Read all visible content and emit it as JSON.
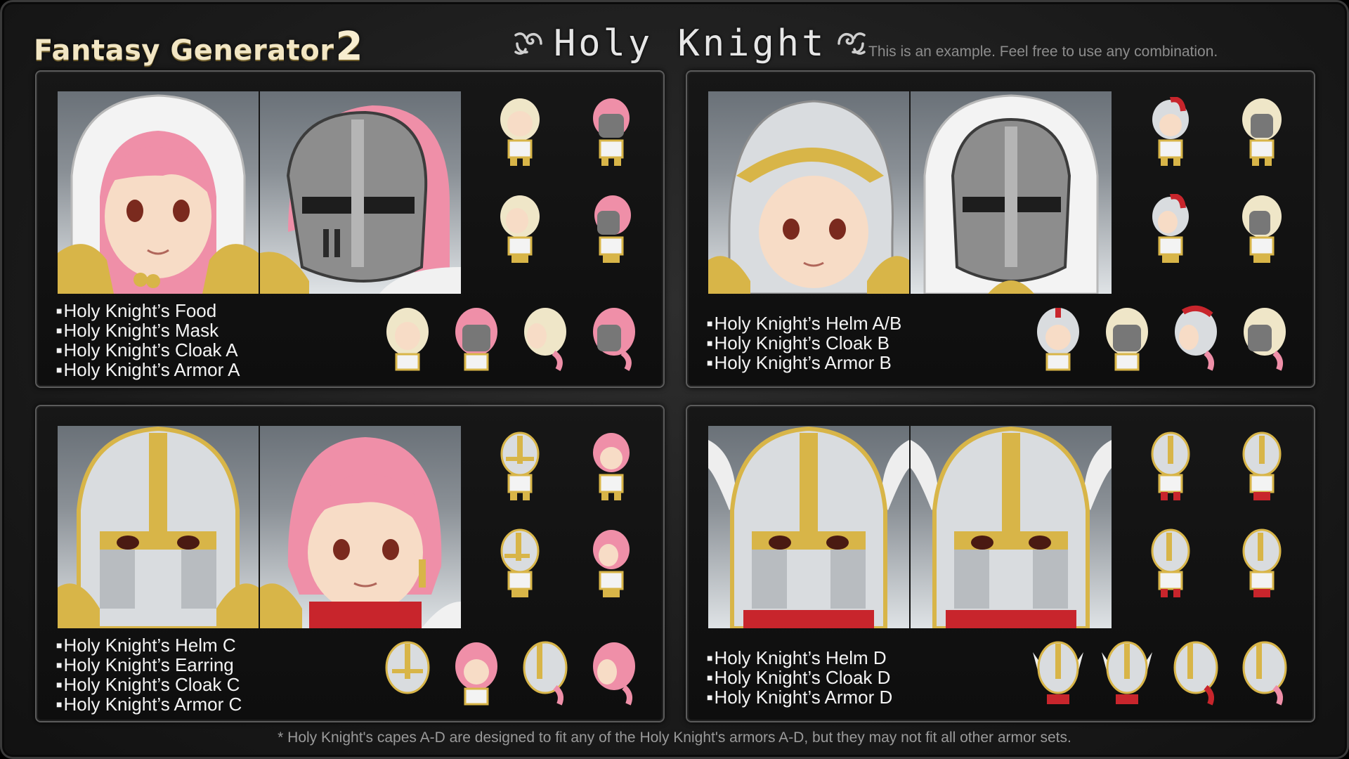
{
  "header": {
    "logo_text": "Fantasy Generator",
    "logo_number": "2",
    "title": "Holy Knight",
    "tagline": "This is an example. Feel free to use any combination."
  },
  "panels": [
    {
      "parts": [
        "Holy Knight’s Food",
        "Holy Knight’s Mask",
        "Holy Knight’s Cloak A",
        "Holy Knight’s Armor A"
      ]
    },
    {
      "parts": [
        "Holy Knight’s Helm A/B",
        "Holy Knight’s Cloak B",
        "Holy Knight’s Armor B"
      ]
    },
    {
      "parts": [
        "Holy Knight’s Helm C",
        "Holy Knight’s Earring",
        "Holy Knight’s Cloak C",
        "Holy Knight’s Armor C"
      ]
    },
    {
      "parts": [
        "Holy Knight’s Helm D",
        "Holy Knight’s Cloak D",
        "Holy Knight’s Armor D"
      ]
    }
  ],
  "footnote": "* Holy Knight's capes A-D are designed to fit any of the Holy Knight's armors A-D, but they may not fit all other armor sets.",
  "colors": {
    "gold": "#d8b548",
    "silver": "#d9dcdf",
    "hair_pink": "#ef8fa8",
    "skin": "#f7dcc6",
    "cloak_white": "#f3f3f3",
    "red": "#c8252c"
  }
}
